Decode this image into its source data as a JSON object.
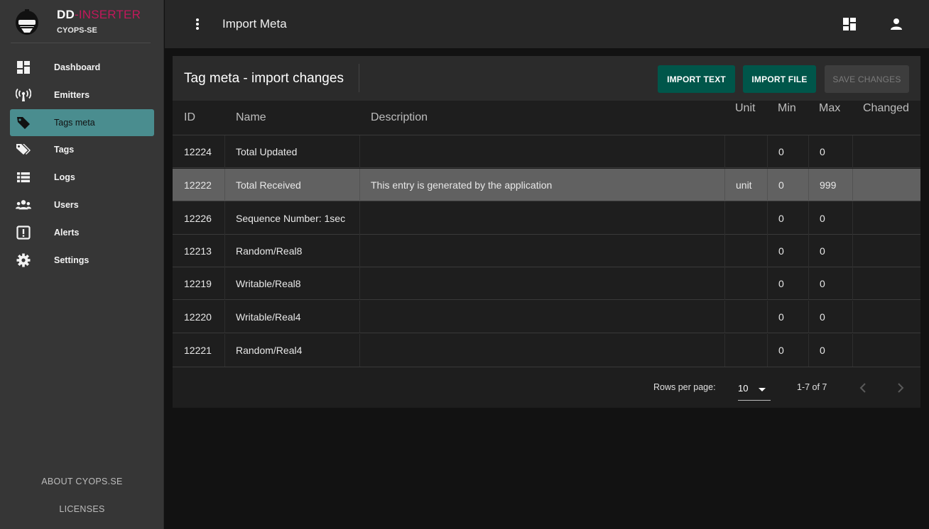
{
  "brand": {
    "name_part1": "DD",
    "name_part2": "-INSERTER",
    "subtitle": "CYOPS-SE"
  },
  "sidebar": {
    "items": [
      {
        "label": "Dashboard",
        "icon": "dashboard-icon"
      },
      {
        "label": "Emitters",
        "icon": "broadcast-icon"
      },
      {
        "label": "Tags meta",
        "icon": "tag-icon",
        "active": true
      },
      {
        "label": "Tags",
        "icon": "tags-icon"
      },
      {
        "label": "Logs",
        "icon": "list-icon"
      },
      {
        "label": "Users",
        "icon": "users-icon"
      },
      {
        "label": "Alerts",
        "icon": "alert-icon"
      },
      {
        "label": "Settings",
        "icon": "gear-icon"
      }
    ],
    "about": "ABOUT CYOPS.SE",
    "licenses": "LICENSES"
  },
  "topbar": {
    "title": "Import Meta"
  },
  "card": {
    "title": "Tag meta - import changes",
    "buttons": {
      "import_text": "IMPORT TEXT",
      "import_file": "IMPORT FILE",
      "save_changes": "SAVE CHANGES"
    }
  },
  "table": {
    "headers": {
      "id": "ID",
      "name": "Name",
      "description": "Description",
      "unit": "Unit",
      "min": "Min",
      "max": "Max",
      "changed": "Changed"
    },
    "rows": [
      {
        "id": "12224",
        "name": "Total Updated",
        "description": "",
        "unit": "",
        "min": "0",
        "max": "0",
        "changed": ""
      },
      {
        "id": "12222",
        "name": "Total Received",
        "description": "This entry is generated by the application",
        "unit": "unit",
        "min": "0",
        "max": "999",
        "changed": "",
        "highlighted": true
      },
      {
        "id": "12226",
        "name": "Sequence Number: 1sec",
        "description": "",
        "unit": "",
        "min": "0",
        "max": "0",
        "changed": ""
      },
      {
        "id": "12213",
        "name": "Random/Real8",
        "description": "",
        "unit": "",
        "min": "0",
        "max": "0",
        "changed": ""
      },
      {
        "id": "12219",
        "name": "Writable/Real8",
        "description": "",
        "unit": "",
        "min": "0",
        "max": "0",
        "changed": ""
      },
      {
        "id": "12220",
        "name": "Writable/Real4",
        "description": "",
        "unit": "",
        "min": "0",
        "max": "0",
        "changed": ""
      },
      {
        "id": "12221",
        "name": "Random/Real4",
        "description": "",
        "unit": "",
        "min": "0",
        "max": "0",
        "changed": ""
      }
    ]
  },
  "pagination": {
    "rows_per_page_label": "Rows per page:",
    "rows_per_page": "10",
    "range": "1-7 of 7"
  },
  "colors": {
    "accent": "#4a8d8f",
    "primary_button": "#00564a",
    "brand_red": "#c2185b"
  }
}
